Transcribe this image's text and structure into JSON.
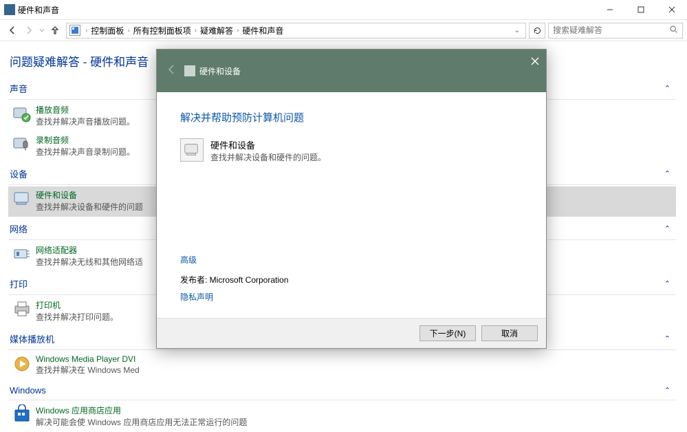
{
  "window": {
    "title": "硬件和声音"
  },
  "breadcrumbs": {
    "c0": "控制面板",
    "c1": "所有控制面板项",
    "c2": "疑难解答",
    "c3": "硬件和声音"
  },
  "search": {
    "placeholder": "搜索疑难解答"
  },
  "page": {
    "title": "问题疑难解答 - 硬件和声音"
  },
  "cats": {
    "sound": "声音",
    "device": "设备",
    "network": "网络",
    "print": "打印",
    "media": "媒体播放机",
    "windows": "Windows"
  },
  "items": {
    "playAudio": {
      "t": "播放音频",
      "d": "查找并解决声音播放问题。"
    },
    "recordAudio": {
      "t": "录制音频",
      "d": "查找并解决声音录制问题。"
    },
    "hwDevice": {
      "t": "硬件和设备",
      "d": "查找并解决设备和硬件的问题"
    },
    "netAdapter": {
      "t": "网络适配器",
      "d": "查找并解决无线和其他网络适"
    },
    "printer": {
      "t": "打印机",
      "d": "查找并解决打印问题。"
    },
    "wmpDvd": {
      "t": "Windows Media Player DVI",
      "d": "查找并解决在 Windows Med"
    },
    "storeApps": {
      "t": "Windows 应用商店应用",
      "d": "解决可能会使 Windows 应用商店应用无法正常运行的问题"
    }
  },
  "wizard": {
    "headerTitle": "硬件和设备",
    "heading": "解决并帮助预防计算机问题",
    "optionTitle": "硬件和设备",
    "optionDesc": "查找并解决设备和硬件的问题。",
    "advanced": "高级",
    "publisherLabel": "发布者:  Microsoft Corporation",
    "privacy": "隐私声明",
    "next": "下一步(N)",
    "cancel": "取消"
  }
}
